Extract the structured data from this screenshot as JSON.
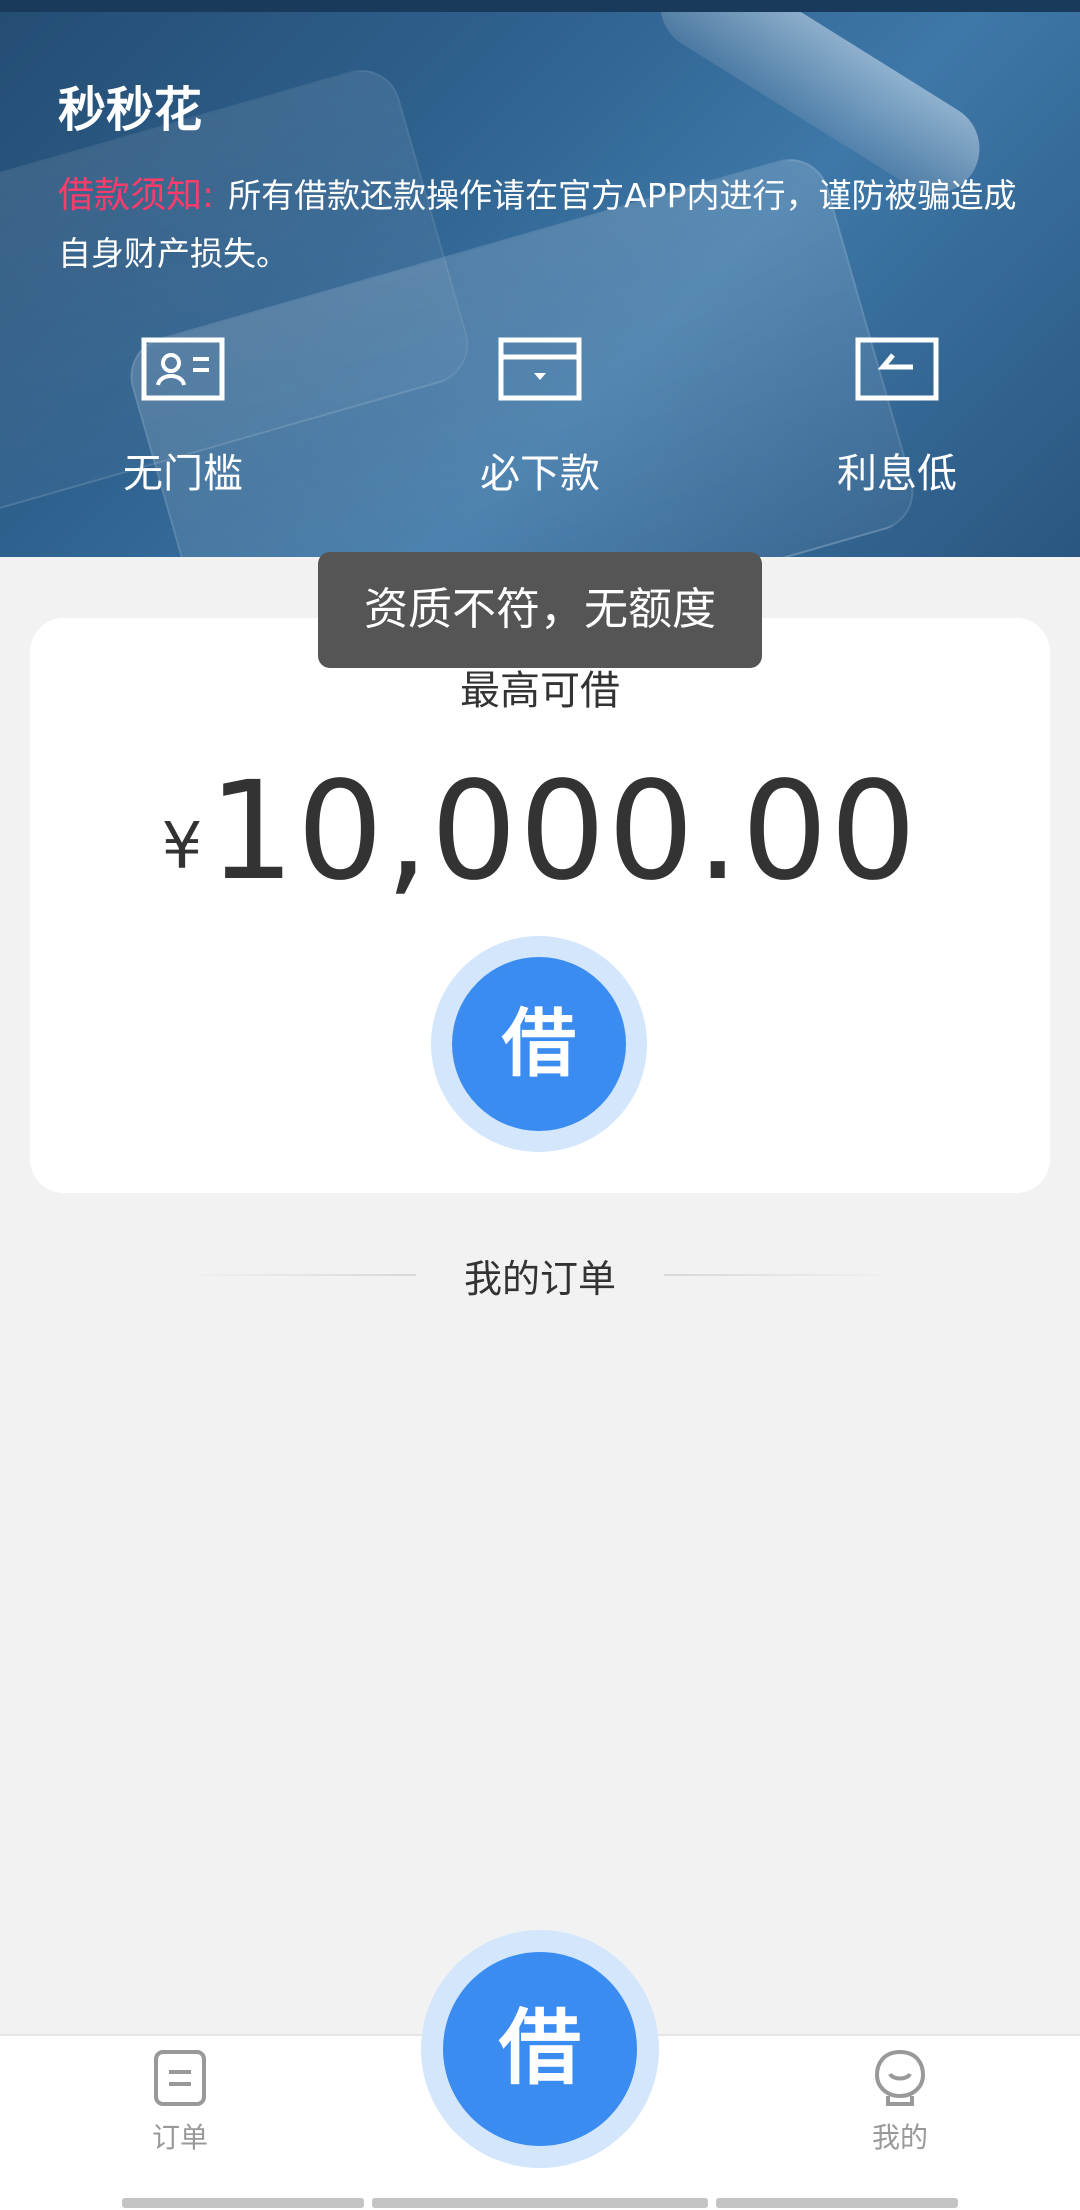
{
  "header": {
    "app_title": "秒秒花",
    "notice_label": "借款须知:",
    "notice_text": "所有借款还款操作请在官方APP内进行，谨防被骗造成自身财产损失。"
  },
  "features": [
    {
      "label": "无门槛",
      "icon": "id-card-icon"
    },
    {
      "label": "必下款",
      "icon": "wallet-icon"
    },
    {
      "label": "利息低",
      "icon": "card-return-icon"
    }
  ],
  "loan_card": {
    "label": "最高可借",
    "currency_symbol": "¥",
    "amount": "10,000.00",
    "borrow_button": "借"
  },
  "toast": {
    "message": "资质不符，无额度"
  },
  "orders_section": {
    "title": "我的订单"
  },
  "tabbar": {
    "orders_label": "订单",
    "center_button": "借",
    "mine_label": "我的"
  },
  "colors": {
    "accent_blue": "#3a8cf0",
    "notice_red": "#ff3b6b",
    "hero_blue": "#2f628f"
  }
}
